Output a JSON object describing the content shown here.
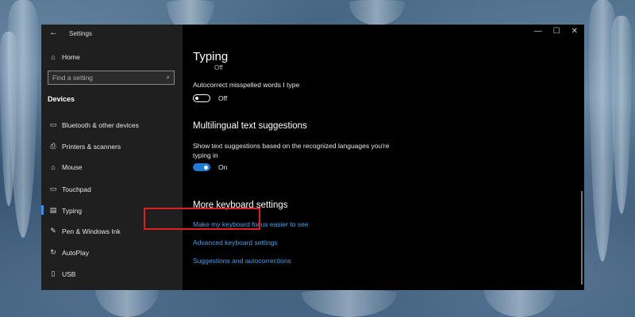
{
  "window": {
    "title": "Settings",
    "controls": [
      "—",
      "☐",
      "✕"
    ]
  },
  "sidebar": {
    "home_label": "Home",
    "search_placeholder": "Find a setting",
    "section_label": "Devices",
    "items": [
      {
        "label": "Bluetooth & other devices",
        "icon": "bluetooth-icon",
        "glyph": "▭"
      },
      {
        "label": "Printers & scanners",
        "icon": "printer-icon",
        "glyph": "⎙"
      },
      {
        "label": "Mouse",
        "icon": "mouse-icon",
        "glyph": "⌂"
      },
      {
        "label": "Touchpad",
        "icon": "touchpad-icon",
        "glyph": "▭"
      },
      {
        "label": "Typing",
        "icon": "keyboard-icon",
        "glyph": "▤",
        "selected": true
      },
      {
        "label": "Pen & Windows Ink",
        "icon": "pen-icon",
        "glyph": "✎"
      },
      {
        "label": "AutoPlay",
        "icon": "autoplay-icon",
        "glyph": "↻"
      },
      {
        "label": "USB",
        "icon": "usb-icon",
        "glyph": "▯"
      }
    ]
  },
  "main": {
    "title": "Typing",
    "peek_text": "Off",
    "autocorrect": {
      "label": "Autocorrect misspelled words I type",
      "state": "Off"
    },
    "multilingual": {
      "heading": "Multilingual text suggestions",
      "description_line1": "Show text suggestions based on the recognized languages you're",
      "description_line2": "typing in",
      "state": "On"
    },
    "more": {
      "heading": "More keyboard settings",
      "links": [
        "Make my keyboard focus easier to see",
        "Advanced keyboard settings",
        "Suggestions and autocorrections"
      ]
    }
  },
  "colors": {
    "accent": "#1f7ad6",
    "link": "#4a9fe8",
    "highlight": "#e0201e",
    "sidebar_bg": "#1f1f1f",
    "content_bg": "#000000"
  }
}
